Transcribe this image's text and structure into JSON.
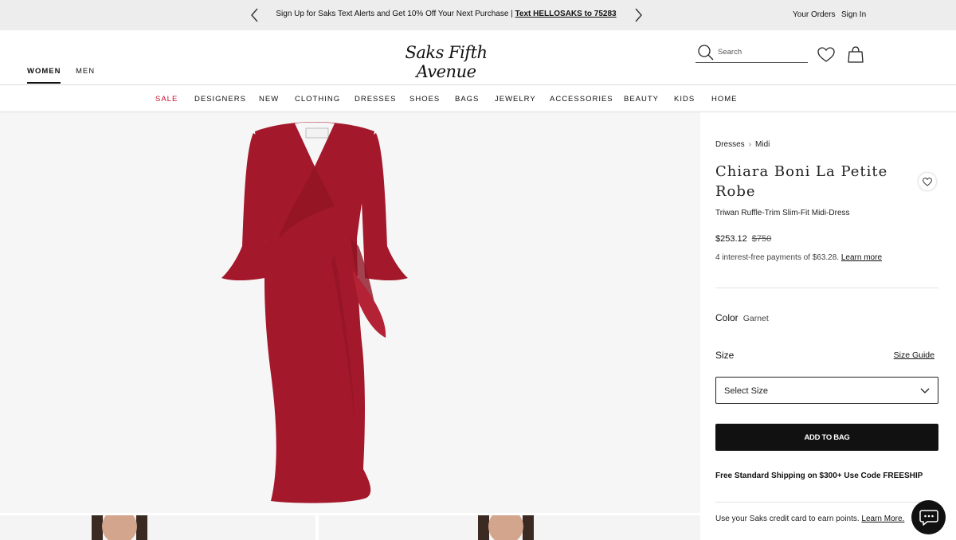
{
  "promo": {
    "message": "Sign Up for Saks Text Alerts and Get 10% Off Your Next Purchase | ",
    "code_link": "Text HELLOSAKS to 75283",
    "your_orders": "Your Orders",
    "sign_in": "Sign In"
  },
  "header": {
    "tabs": {
      "women": "WOMEN",
      "men": "MEN"
    },
    "logo": "Saks Fifth Avenue",
    "search_placeholder": "Search"
  },
  "nav": [
    "SALE",
    "DESIGNERS",
    "NEW",
    "CLOTHING",
    "DRESSES",
    "SHOES",
    "BAGS",
    "JEWELRY",
    "ACCESSORIES",
    "BEAUTY",
    "KIDS",
    "HOME"
  ],
  "product": {
    "breadcrumb": [
      "Dresses",
      "Midi"
    ],
    "brand": "Chiara Boni La Petite Robe",
    "name": "Triwan Ruffle-Trim Slim-Fit Midi-Dress",
    "sale_price": "$253.12",
    "original_price": "$750",
    "installments_text": "4 interest-free payments of $63.28. ",
    "installments_link": "Learn more",
    "color_label": "Color",
    "color_value": "Garnet",
    "size_label": "Size",
    "size_guide": "Size Guide",
    "size_select": "Select Size",
    "add_to_bag": "ADD TO BAG",
    "shipping": "Free Standard Shipping on $300+ Use Code FREESHIP",
    "credit_text": "Use your Saks credit card to earn points. ",
    "credit_link": "Learn More."
  },
  "colors": {
    "sale_red": "#c8102e",
    "dress_garnet": "#a3182b",
    "promo_bg": "#ededed",
    "gallery_bg": "#f6f6f6"
  },
  "icons": [
    "chevron-left-icon",
    "chevron-right-icon",
    "search-icon",
    "heart-icon",
    "shopping-bag-icon",
    "chevron-down-icon",
    "chat-icon"
  ]
}
